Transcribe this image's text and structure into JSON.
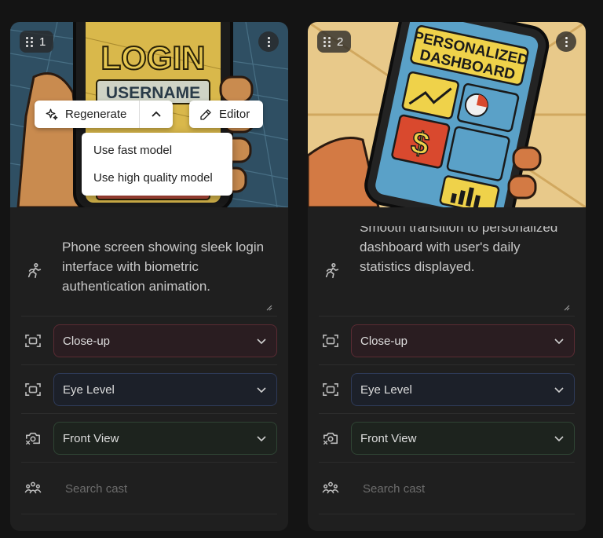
{
  "cards": [
    {
      "number": "1",
      "image_alt": "Comic-style illustration of a hand holding a phone with LOGIN and USERNAME on screen",
      "image_text": [
        "LOGIN",
        "USERNAME"
      ],
      "prompt": "Phone screen showing sleek login interface with biometric authentication animation.",
      "shot_type": "Close-up",
      "camera_angle": "Eye Level",
      "view": "Front View",
      "cast_placeholder": "Search cast"
    },
    {
      "number": "2",
      "image_alt": "Comic-style illustration of a hand holding a phone showing a personalized dashboard",
      "image_text": [
        "PERSONALIZED",
        "DASHBOARD"
      ],
      "prompt": "Smooth transition to personalized dashboard with user's daily statistics displayed.",
      "shot_type": "Close-up",
      "camera_angle": "Eye Level",
      "view": "Front View",
      "cast_placeholder": "Search cast"
    }
  ],
  "overlay": {
    "regenerate_label": "Regenerate",
    "editor_label": "Editor",
    "menu_items": [
      "Use fast model",
      "Use high quality model"
    ]
  },
  "icons": {
    "row_prompt": "running-figure-icon",
    "row_shot": "frame-icon",
    "row_angle": "frame-icon",
    "row_view": "camera-rotate-icon",
    "row_cast": "people-icon"
  },
  "colors": {
    "background": "#141414",
    "card": "#1f1f1f",
    "select_red_border": "#5a2b33",
    "select_blue_border": "#2e3a58",
    "select_green_border": "#2f4434"
  }
}
